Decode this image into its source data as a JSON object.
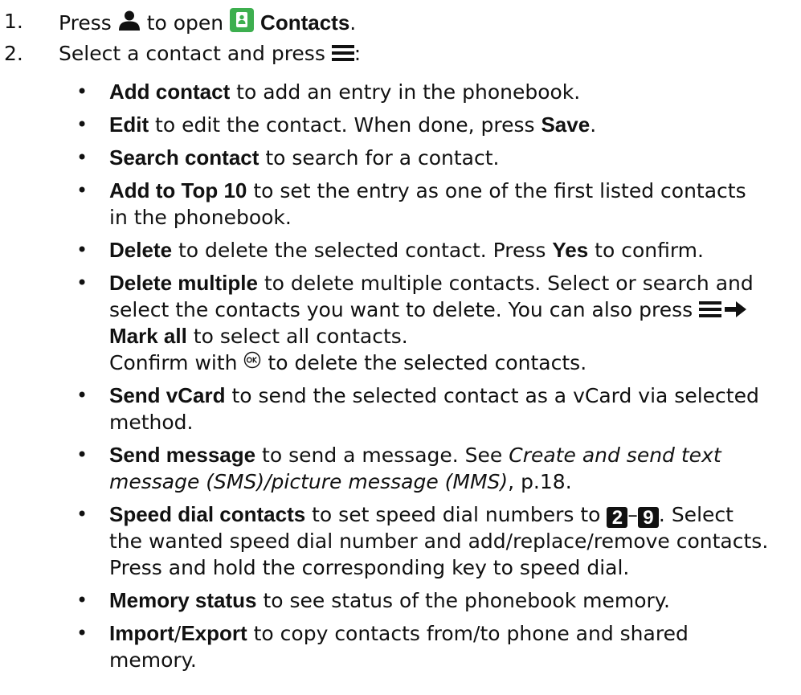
{
  "steps": [
    {
      "num": "1.",
      "pre": "Press ",
      "mid": " to open ",
      "bold": "Contacts",
      "post": "."
    },
    {
      "num": "2.",
      "pre": "Select a contact and press ",
      "post": ":"
    }
  ],
  "bullets": [
    {
      "bold": "Add contact",
      "text": " to add an entry in the phonebook."
    },
    {
      "bold": "Edit",
      "text": " to edit the contact. When done, press ",
      "bold2": "Save",
      "text2": "."
    },
    {
      "bold": "Search contact",
      "text": " to search for a contact."
    },
    {
      "bold": "Add to Top 10",
      "line1": " to set the entry as one of the first listed contacts",
      "line2": "in the phonebook."
    },
    {
      "bold": "Delete",
      "text": " to delete the selected contact. Press ",
      "bold2": "Yes",
      "text2": " to confirm."
    },
    {
      "bold": "Delete multiple",
      "line1": " to delete multiple contacts. Select or search and",
      "line2": "select the contacts you want to delete. You can also press ",
      "line3_bold": "Mark all",
      "line3": " to select all contacts.",
      "line4_pre": "Confirm with ",
      "line4_post": " to delete the selected contacts."
    },
    {
      "bold": "Send vCard",
      "line1": " to send the selected contact as a vCard via selected",
      "line2": "method."
    },
    {
      "bold": "Send message",
      "line1": " to send a message. See ",
      "line1_italic": "Create and send text",
      "line2_italic": "message (SMS)/picture message (MMS)",
      "line2": ", p.18."
    },
    {
      "bold": "Speed dial contacts",
      "line1": " to set speed dial numbers to ",
      "key_from": "2",
      "dash": "–",
      "key_to": "9",
      "line1_end": ". Select",
      "line2": "the wanted speed dial number and add/replace/remove contacts.",
      "line3": "Press and hold the corresponding key to speed dial."
    },
    {
      "bold": "Memory status",
      "text": " to see status of the phonebook memory."
    },
    {
      "bold": "Import",
      "slash": "/",
      "bold2": "Export",
      "line1": " to copy contacts from/to phone and shared",
      "line2": "memory."
    }
  ],
  "bullet_char": "•",
  "colors": {
    "contacts_icon": "#3daf4f",
    "text": "#111111"
  },
  "icons": {
    "person": "person-icon",
    "contacts": "contacts-app-icon",
    "menu": "menu-icon",
    "arrow": "arrow-right-icon",
    "ok": "ok-key-icon"
  }
}
